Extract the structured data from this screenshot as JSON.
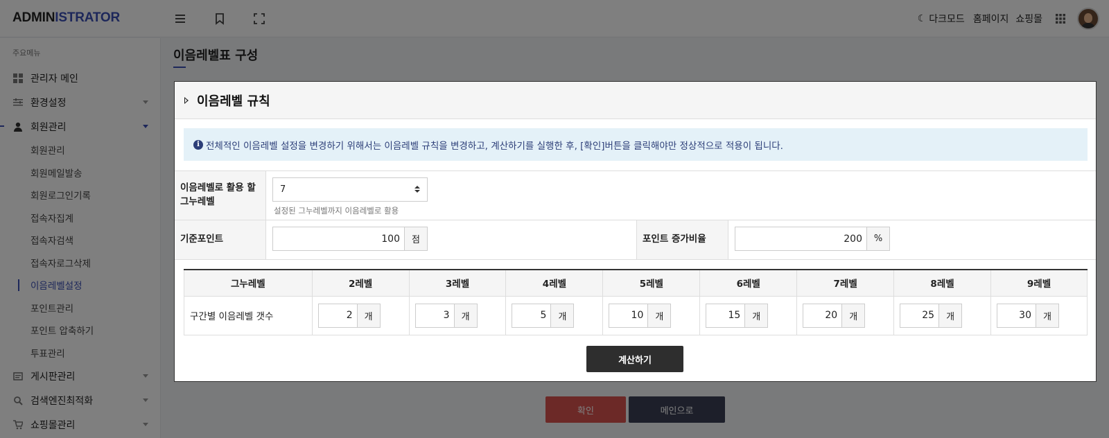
{
  "header": {
    "logo_part1": "ADMIN",
    "logo_part2": "ISTRATOR",
    "icons": [
      "menu-icon",
      "bookmark-icon",
      "fullscreen-icon"
    ],
    "dark_mode_label": "다크모드",
    "homepage_label": "홈페이지",
    "shop_label": "쇼핑몰"
  },
  "sidebar": {
    "heading": "주요메뉴",
    "items": [
      {
        "label": "관리자 메인",
        "icon": "dashboard-icon"
      },
      {
        "label": "환경설정",
        "icon": "sliders-icon"
      },
      {
        "label": "회원관리",
        "icon": "user-icon"
      }
    ],
    "submenu": [
      "회원관리",
      "회원메일발송",
      "회원로그인기록",
      "접속자집계",
      "접속자검색",
      "접속자로그삭제",
      "이음레벨설정",
      "포인트관리",
      "포인트 압축하기",
      "투표관리"
    ],
    "active_sub": "이음레벨설정",
    "items_after": [
      {
        "label": "게시판관리",
        "icon": "board-icon"
      },
      {
        "label": "검색엔진최적화",
        "icon": "search-icon"
      },
      {
        "label": "쇼핑몰관리",
        "icon": "cart-icon"
      }
    ]
  },
  "main": {
    "page_title": "이음레벨표 구성",
    "confirm_label": "확인",
    "main_label": "메인으로"
  },
  "modal": {
    "title": "이음레벨 규칙",
    "notice": "전체적인 이음레벨 설정을 변경하기 위해서는 이음레벨 규칙을 변경하고, 계산하기를 실행한 후, [확인]버튼을 클릭해야만 정상적으로 적용이 됩니다.",
    "grade_label_line1": "이음레벨로 활용 할",
    "grade_label_line2": "그누레벨",
    "grade_value": "7",
    "grade_help": "설정된 그누레벨까지 이음레벨로 활용",
    "base_point_label": "기준포인트",
    "base_point_value": "100",
    "base_point_unit": "점",
    "increase_label": "포인트 증가비율",
    "increase_value": "200",
    "increase_unit": "%",
    "table_header_first": "그누레벨",
    "row_label": "구간별 이음레벨 갯수",
    "unit": "개",
    "levels": [
      "2레벨",
      "3레벨",
      "4레벨",
      "5레벨",
      "6레벨",
      "7레벨",
      "8레벨",
      "9레벨"
    ],
    "counts": [
      "2",
      "3",
      "5",
      "10",
      "15",
      "20",
      "25",
      "30"
    ],
    "calc_label": "계산하기"
  },
  "colors": {
    "accent": "#3b4fb5",
    "confirm": "#d9534f",
    "notice_bg": "#e4f1f8",
    "notice_text": "#2c3e78",
    "dark_button": "#2e2e2e"
  }
}
